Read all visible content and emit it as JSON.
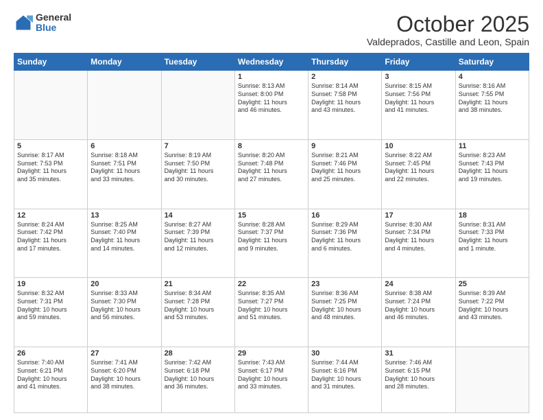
{
  "header": {
    "logo": {
      "general": "General",
      "blue": "Blue"
    },
    "title": "October 2025",
    "subtitle": "Valdeprados, Castille and Leon, Spain"
  },
  "weekdays": [
    "Sunday",
    "Monday",
    "Tuesday",
    "Wednesday",
    "Thursday",
    "Friday",
    "Saturday"
  ],
  "weeks": [
    [
      {
        "day": "",
        "text": ""
      },
      {
        "day": "",
        "text": ""
      },
      {
        "day": "",
        "text": ""
      },
      {
        "day": "1",
        "text": "Sunrise: 8:13 AM\nSunset: 8:00 PM\nDaylight: 11 hours\nand 46 minutes."
      },
      {
        "day": "2",
        "text": "Sunrise: 8:14 AM\nSunset: 7:58 PM\nDaylight: 11 hours\nand 43 minutes."
      },
      {
        "day": "3",
        "text": "Sunrise: 8:15 AM\nSunset: 7:56 PM\nDaylight: 11 hours\nand 41 minutes."
      },
      {
        "day": "4",
        "text": "Sunrise: 8:16 AM\nSunset: 7:55 PM\nDaylight: 11 hours\nand 38 minutes."
      }
    ],
    [
      {
        "day": "5",
        "text": "Sunrise: 8:17 AM\nSunset: 7:53 PM\nDaylight: 11 hours\nand 35 minutes."
      },
      {
        "day": "6",
        "text": "Sunrise: 8:18 AM\nSunset: 7:51 PM\nDaylight: 11 hours\nand 33 minutes."
      },
      {
        "day": "7",
        "text": "Sunrise: 8:19 AM\nSunset: 7:50 PM\nDaylight: 11 hours\nand 30 minutes."
      },
      {
        "day": "8",
        "text": "Sunrise: 8:20 AM\nSunset: 7:48 PM\nDaylight: 11 hours\nand 27 minutes."
      },
      {
        "day": "9",
        "text": "Sunrise: 8:21 AM\nSunset: 7:46 PM\nDaylight: 11 hours\nand 25 minutes."
      },
      {
        "day": "10",
        "text": "Sunrise: 8:22 AM\nSunset: 7:45 PM\nDaylight: 11 hours\nand 22 minutes."
      },
      {
        "day": "11",
        "text": "Sunrise: 8:23 AM\nSunset: 7:43 PM\nDaylight: 11 hours\nand 19 minutes."
      }
    ],
    [
      {
        "day": "12",
        "text": "Sunrise: 8:24 AM\nSunset: 7:42 PM\nDaylight: 11 hours\nand 17 minutes."
      },
      {
        "day": "13",
        "text": "Sunrise: 8:25 AM\nSunset: 7:40 PM\nDaylight: 11 hours\nand 14 minutes."
      },
      {
        "day": "14",
        "text": "Sunrise: 8:27 AM\nSunset: 7:39 PM\nDaylight: 11 hours\nand 12 minutes."
      },
      {
        "day": "15",
        "text": "Sunrise: 8:28 AM\nSunset: 7:37 PM\nDaylight: 11 hours\nand 9 minutes."
      },
      {
        "day": "16",
        "text": "Sunrise: 8:29 AM\nSunset: 7:36 PM\nDaylight: 11 hours\nand 6 minutes."
      },
      {
        "day": "17",
        "text": "Sunrise: 8:30 AM\nSunset: 7:34 PM\nDaylight: 11 hours\nand 4 minutes."
      },
      {
        "day": "18",
        "text": "Sunrise: 8:31 AM\nSunset: 7:33 PM\nDaylight: 11 hours\nand 1 minute."
      }
    ],
    [
      {
        "day": "19",
        "text": "Sunrise: 8:32 AM\nSunset: 7:31 PM\nDaylight: 10 hours\nand 59 minutes."
      },
      {
        "day": "20",
        "text": "Sunrise: 8:33 AM\nSunset: 7:30 PM\nDaylight: 10 hours\nand 56 minutes."
      },
      {
        "day": "21",
        "text": "Sunrise: 8:34 AM\nSunset: 7:28 PM\nDaylight: 10 hours\nand 53 minutes."
      },
      {
        "day": "22",
        "text": "Sunrise: 8:35 AM\nSunset: 7:27 PM\nDaylight: 10 hours\nand 51 minutes."
      },
      {
        "day": "23",
        "text": "Sunrise: 8:36 AM\nSunset: 7:25 PM\nDaylight: 10 hours\nand 48 minutes."
      },
      {
        "day": "24",
        "text": "Sunrise: 8:38 AM\nSunset: 7:24 PM\nDaylight: 10 hours\nand 46 minutes."
      },
      {
        "day": "25",
        "text": "Sunrise: 8:39 AM\nSunset: 7:22 PM\nDaylight: 10 hours\nand 43 minutes."
      }
    ],
    [
      {
        "day": "26",
        "text": "Sunrise: 7:40 AM\nSunset: 6:21 PM\nDaylight: 10 hours\nand 41 minutes."
      },
      {
        "day": "27",
        "text": "Sunrise: 7:41 AM\nSunset: 6:20 PM\nDaylight: 10 hours\nand 38 minutes."
      },
      {
        "day": "28",
        "text": "Sunrise: 7:42 AM\nSunset: 6:18 PM\nDaylight: 10 hours\nand 36 minutes."
      },
      {
        "day": "29",
        "text": "Sunrise: 7:43 AM\nSunset: 6:17 PM\nDaylight: 10 hours\nand 33 minutes."
      },
      {
        "day": "30",
        "text": "Sunrise: 7:44 AM\nSunset: 6:16 PM\nDaylight: 10 hours\nand 31 minutes."
      },
      {
        "day": "31",
        "text": "Sunrise: 7:46 AM\nSunset: 6:15 PM\nDaylight: 10 hours\nand 28 minutes."
      },
      {
        "day": "",
        "text": ""
      }
    ]
  ]
}
